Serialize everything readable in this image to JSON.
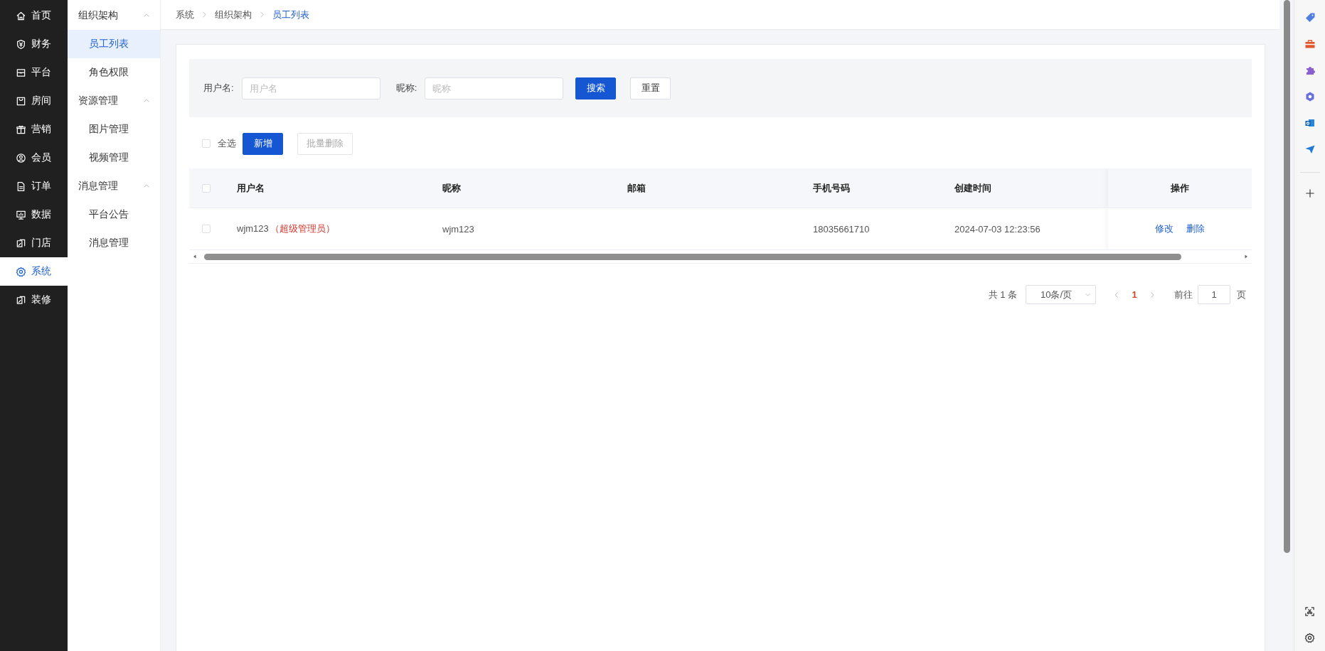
{
  "nav": {
    "items": [
      {
        "label": "首页",
        "selected": false
      },
      {
        "label": "财务",
        "selected": false
      },
      {
        "label": "平台",
        "selected": false
      },
      {
        "label": "房间",
        "selected": false
      },
      {
        "label": "营销",
        "selected": false
      },
      {
        "label": "会员",
        "selected": false
      },
      {
        "label": "订单",
        "selected": false
      },
      {
        "label": "数据",
        "selected": false
      },
      {
        "label": "门店",
        "selected": false
      },
      {
        "label": "系统",
        "selected": true
      },
      {
        "label": "装修",
        "selected": false
      }
    ]
  },
  "submenu": {
    "groups": [
      {
        "label": "组织架构",
        "expanded": true,
        "children": [
          {
            "label": "员工列表",
            "selected": true
          },
          {
            "label": "角色权限",
            "selected": false
          }
        ]
      },
      {
        "label": "资源管理",
        "expanded": true,
        "children": [
          {
            "label": "图片管理",
            "selected": false
          },
          {
            "label": "视频管理",
            "selected": false
          }
        ]
      },
      {
        "label": "消息管理",
        "expanded": true,
        "children": [
          {
            "label": "平台公告",
            "selected": false
          },
          {
            "label": "消息管理",
            "selected": false
          }
        ]
      }
    ]
  },
  "breadcrumb": [
    {
      "label": "系统",
      "current": false
    },
    {
      "label": "组织架构",
      "current": false
    },
    {
      "label": "员工列表",
      "current": true
    }
  ],
  "search": {
    "fields": [
      {
        "label": "用户名:",
        "placeholder": "用户名"
      },
      {
        "label": "昵称:",
        "placeholder": "昵称"
      }
    ],
    "buttons": [
      {
        "label": "搜索",
        "kind": "primary"
      },
      {
        "label": "重置",
        "kind": "default"
      }
    ]
  },
  "toolbar": {
    "select_all": {
      "label": "全选",
      "checked": false
    },
    "buttons": [
      {
        "label": "新增",
        "kind": "primary",
        "disabled": false
      },
      {
        "label": "批量删除",
        "kind": "default",
        "disabled": true
      }
    ]
  },
  "table": {
    "all_checked": false,
    "columns": [
      "用户名",
      "昵称",
      "邮箱",
      "手机号码",
      "创建时间"
    ],
    "action_column": "操作",
    "rows": [
      {
        "selected": false,
        "username": "wjm123",
        "role_tag": "（超级管理员）",
        "nickname": "wjm123",
        "phone": "18035661710",
        "created": "2024-07-03 12:23:56",
        "actions": [
          "修改",
          "删除"
        ]
      }
    ]
  },
  "pagination": {
    "total": "共 1 条",
    "page_size": "10条/页",
    "pages": [
      {
        "label": "1",
        "selected": true
      }
    ],
    "goto_label": "前往",
    "goto_value": "1",
    "goto_suffix": "页"
  }
}
